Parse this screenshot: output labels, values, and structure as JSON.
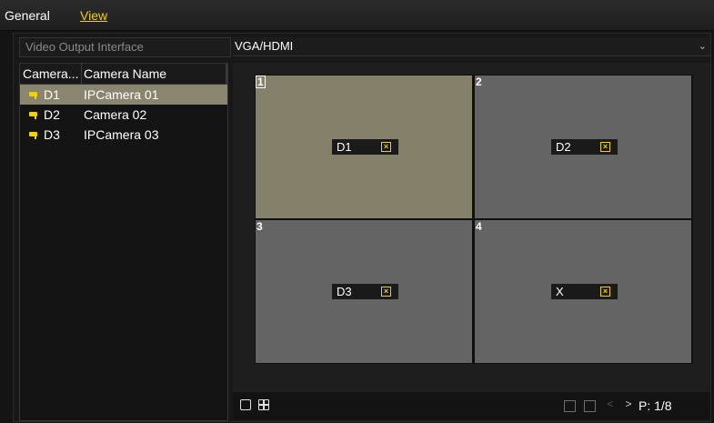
{
  "tabs": [
    {
      "label": "General",
      "active": false
    },
    {
      "label": "View",
      "active": true
    }
  ],
  "video_output": {
    "label": "Video Output Interface",
    "value": "VGA/HDMI"
  },
  "camera_list": {
    "headers": [
      "Camera...",
      "Camera Name"
    ],
    "rows": [
      {
        "id": "D1",
        "name": "IPCamera 01",
        "selected": true
      },
      {
        "id": "D2",
        "name": "Camera 02",
        "selected": false
      },
      {
        "id": "D3",
        "name": "IPCamera 03",
        "selected": false
      }
    ]
  },
  "view_cells": [
    {
      "number": "1",
      "label": "D1",
      "active": true
    },
    {
      "number": "2",
      "label": "D2",
      "active": false
    },
    {
      "number": "3",
      "label": "D3",
      "active": false
    },
    {
      "number": "4",
      "label": "X",
      "active": false
    }
  ],
  "close_glyph": "×",
  "bottom_bar": {
    "prev_glyph": "<",
    "next_glyph": ">",
    "page": "P: 1/8"
  },
  "colors": {
    "accent": "#f0d200",
    "selected_row": "#8a856f",
    "active_cell": "#858069",
    "cell": "#646464"
  }
}
